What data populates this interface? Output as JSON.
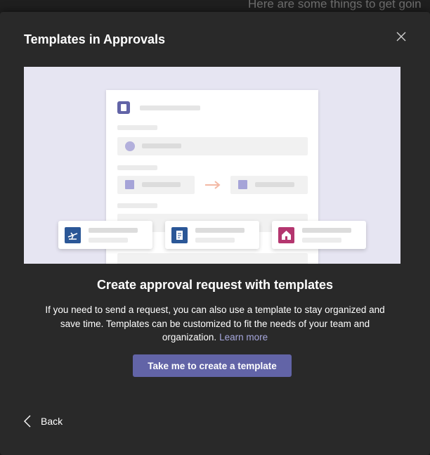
{
  "background": {
    "text": "Here are some things to get goin"
  },
  "dialog": {
    "title": "Templates in Approvals",
    "close_icon": "close-icon",
    "illustration": {
      "cards": [
        {
          "icon": "airplane-icon",
          "color": "#2b5797"
        },
        {
          "icon": "receipt-icon",
          "color": "#2b5797"
        },
        {
          "icon": "home-icon",
          "color": "#b4366f"
        }
      ],
      "accent_color": "#6264a7",
      "arrow_color": "#f3b9a5"
    },
    "heading": "Create approval request with templates",
    "description": "If you need to send a request, you can also use a template to stay organized and save time. Templates can be customized to fit the needs of your team and organization.",
    "learn_more": "Learn more",
    "cta_label": "Take me to create a template",
    "back_label": "Back",
    "colors": {
      "dialog_bg": "#292929",
      "brand": "#6264a7",
      "link": "#a6a7dc"
    }
  }
}
